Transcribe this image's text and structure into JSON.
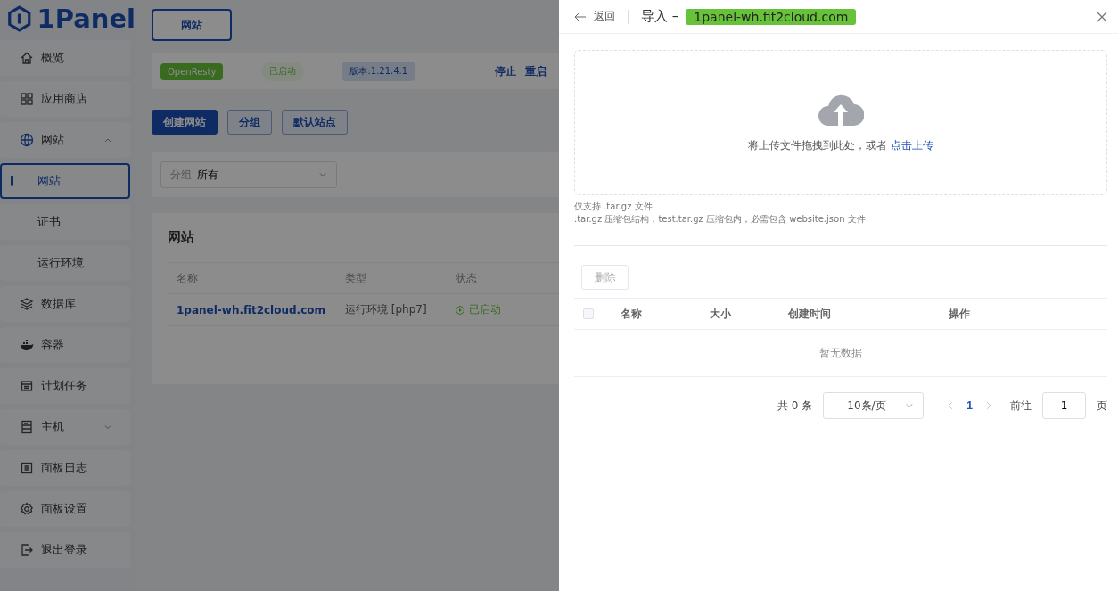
{
  "logo": {
    "text": "1Panel"
  },
  "sidebar": {
    "items": [
      {
        "label": "概览",
        "selected": false
      },
      {
        "label": "应用商店",
        "selected": false
      },
      {
        "label": "网站",
        "expanded": true,
        "selected": false,
        "children": [
          {
            "label": "网站",
            "selected": true
          },
          {
            "label": "证书",
            "selected": false
          },
          {
            "label": "运行环境",
            "selected": false
          }
        ]
      },
      {
        "label": "数据库",
        "selected": false
      },
      {
        "label": "容器",
        "selected": false
      },
      {
        "label": "计划任务",
        "selected": false
      },
      {
        "label": "主机",
        "expanded": false,
        "selected": false
      },
      {
        "label": "面板日志",
        "selected": false
      },
      {
        "label": "面板设置",
        "selected": false
      },
      {
        "label": "退出登录",
        "selected": false
      }
    ]
  },
  "top_tab": "网站",
  "status_card": {
    "app": "OpenResty",
    "status": "已启动",
    "version": "版本:1.21.4.1",
    "actions": [
      "停止",
      "重启"
    ]
  },
  "actions": [
    {
      "label": "创建网站",
      "kind": "primary"
    },
    {
      "label": "分组",
      "kind": "plain"
    },
    {
      "label": "默认站点",
      "kind": "plain"
    }
  ],
  "filter": {
    "label": "分组",
    "value": "所有"
  },
  "websites": {
    "title": "网站",
    "columns": [
      "名称",
      "类型",
      "状态"
    ],
    "rows": [
      {
        "name": "1panel-wh.fit2cloud.com",
        "type": "运行环境 [php7]",
        "status": "已启动"
      }
    ]
  },
  "drawer": {
    "back": "返回",
    "title": "导入 –",
    "site": "1panel-wh.fit2cloud.com",
    "upload": {
      "text": "将上传文件拖拽到此处，或者",
      "link": "点击上传"
    },
    "hints": [
      "仅支持 .tar.gz 文件",
      ".tar.gz 压缩包结构：test.tar.gz 压缩包内，必需包含 website.json 文件"
    ],
    "delete_button": "删除",
    "table": {
      "select_all_checked": false,
      "columns": [
        "名称",
        "大小",
        "创建时间",
        "操作"
      ],
      "empty": "暂无数据"
    },
    "pagination": {
      "total": "共 0 条",
      "page_size": "10条/页",
      "pages": [
        {
          "label": "1",
          "selected": true
        }
      ],
      "goto": "前往",
      "goto_value": "1",
      "page_unit": "页"
    }
  }
}
